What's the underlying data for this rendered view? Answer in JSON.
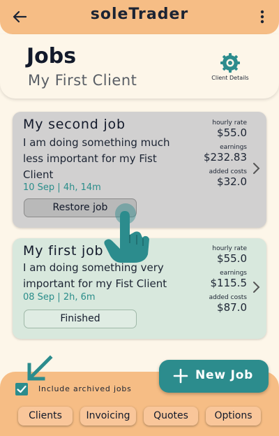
{
  "app_bar": {
    "title": "soleTrader",
    "back_icon": "arrow-left-icon",
    "menu_icon": "more-vert-icon"
  },
  "header": {
    "title": "Jobs",
    "client_name": "My First Client",
    "client_details_label": "Client Details",
    "client_details_icon": "gear-icon"
  },
  "jobs": [
    {
      "title": "My second job",
      "description": "I am doing something much less important for my Fist Client",
      "meta": "10 Sep | 4h, 14m",
      "hourly_rate_label": "hourly rate",
      "hourly_rate": "$55.0",
      "earnings_label": "earnings",
      "earnings": "$232.83",
      "added_costs_label": "added costs",
      "added_costs": "$32.0",
      "button_label": "Restore job",
      "archived": true
    },
    {
      "title": "My first job",
      "description": "I am doing something very important for my Fist Client",
      "meta": "08 Sep | 2h, 6m",
      "hourly_rate_label": "hourly rate",
      "hourly_rate": "$55.0",
      "earnings_label": "earnings",
      "earnings": "$115.5",
      "added_costs_label": "added costs",
      "added_costs": "$87.0",
      "button_label": "Finished",
      "archived": false
    }
  ],
  "fab": {
    "label": "New Job",
    "icon": "plus-icon"
  },
  "archived_toggle": {
    "label": "Include archived jobs",
    "checked": true
  },
  "bottom_nav": [
    {
      "label": "Clients"
    },
    {
      "label": "Invoicing"
    },
    {
      "label": "Quotes"
    },
    {
      "label": "Options"
    }
  ],
  "colors": {
    "accent": "#2c8c8d",
    "bar": "#f6bd85",
    "background": "#fdf6e9",
    "active_card": "#d8e8dd",
    "archived_card": "#d1d0d0"
  }
}
